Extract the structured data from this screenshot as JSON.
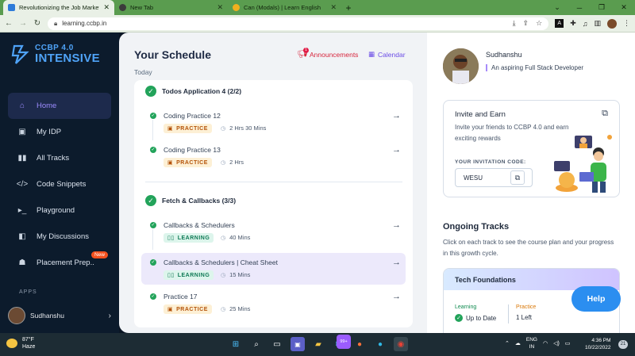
{
  "browser": {
    "tabs": [
      {
        "title": "Revolutionizing the Job Market |",
        "color": "#2e7bd9"
      },
      {
        "title": "New Tab",
        "color": "#3b3b3b"
      },
      {
        "title": "Can (Modals) | Learn English",
        "color": "#f2b01e"
      }
    ],
    "url": "learning.ccbp.in"
  },
  "sidebar": {
    "logo_line1": "CCBP 4.0",
    "logo_line2": "INTENSIVE",
    "items": [
      {
        "label": "Home",
        "icon": "home-icon"
      },
      {
        "label": "My IDP",
        "icon": "idp-icon"
      },
      {
        "label": "All Tracks",
        "icon": "book-icon"
      },
      {
        "label": "Code Snippets",
        "icon": "code-icon"
      },
      {
        "label": "Playground",
        "icon": "terminal-icon"
      },
      {
        "label": "My Discussions",
        "icon": "chat-icon"
      },
      {
        "label": "Placement Prep..",
        "icon": "user-icon",
        "badge": "New"
      }
    ],
    "apps_label": "APPS",
    "user_name": "Sudhanshu"
  },
  "schedule": {
    "title": "Your Schedule",
    "subtitle": "Today",
    "announcements": "Announcements",
    "announcements_count": "1",
    "calendar": "Calendar",
    "groups": [
      {
        "title": "Todos Application 4 (2/2)",
        "items": [
          {
            "name": "Coding Practice 12",
            "tag": "PRACTICE",
            "duration": "2 Hrs 30 Mins"
          },
          {
            "name": "Coding Practice 13",
            "tag": "PRACTICE",
            "duration": "2 Hrs"
          }
        ]
      },
      {
        "title": "Fetch & Callbacks (3/3)",
        "items": [
          {
            "name": "Callbacks & Schedulers",
            "tag": "LEARNING",
            "duration": "40 Mins"
          },
          {
            "name": "Callbacks & Schedulers | Cheat Sheet",
            "tag": "LEARNING",
            "duration": "15 Mins"
          },
          {
            "name": "Practice 17",
            "tag": "PRACTICE",
            "duration": "25 Mins"
          }
        ]
      }
    ]
  },
  "profile": {
    "name": "Sudhanshu",
    "bio": "An aspiring Full Stack Developer"
  },
  "invite": {
    "title": "Invite and Earn",
    "text": "Invite your friends to CCBP 4.0 and earn exciting rewards",
    "code_label": "YOUR INVITATION CODE:",
    "code": "WESU"
  },
  "ongoing": {
    "title": "Ongoing Tracks",
    "text": "Click on each track to see the course plan and your progress in this growth cycle.",
    "track_title": "Tech Foundations",
    "learning_label": "Learning",
    "learning_value": "Up to Date",
    "practice_label": "Practice",
    "practice_value": "1 Left"
  },
  "help_label": "Help",
  "taskbar": {
    "temp": "87°F",
    "condition": "Haze",
    "lang1": "ENG",
    "lang2": "IN",
    "time": "4:36 PM",
    "date": "10/22/2022",
    "mail_badge": "99+",
    "notif_count": "21"
  }
}
